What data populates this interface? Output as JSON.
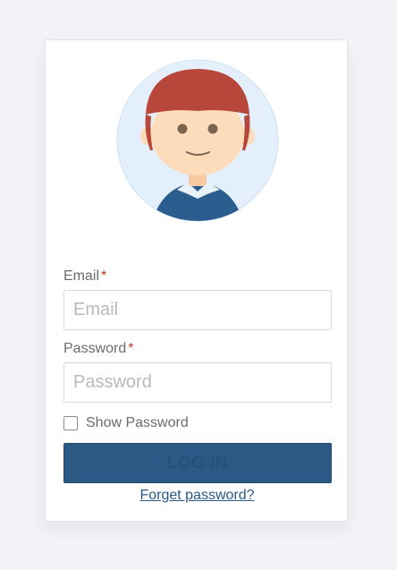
{
  "login_form": {
    "avatar_icon": "user-avatar-icon",
    "email": {
      "label": "Email",
      "required_mark": "*",
      "value": "",
      "placeholder": "Email"
    },
    "password": {
      "label": "Password",
      "required_mark": "*",
      "value": "",
      "placeholder": "Password"
    },
    "show_password": {
      "label": "Show Password",
      "checked": false
    },
    "login_button_label": "LOG IN",
    "forget_password_link": "Forget password?"
  },
  "colors": {
    "page_background": "#f2f3f7",
    "primary": "#2b5985",
    "required": "#c0392b",
    "avatar_background": "#e3f0fb",
    "avatar_hair": "#b7473b",
    "avatar_skin": "#fcdcbb",
    "avatar_shirt": "#2c5d8f"
  }
}
